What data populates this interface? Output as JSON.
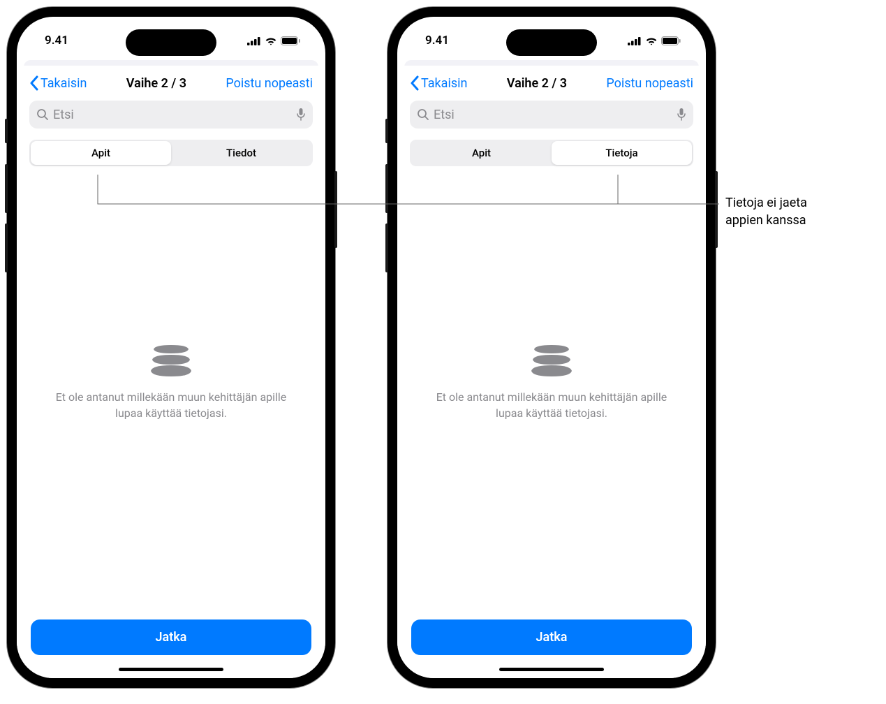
{
  "status": {
    "time": "9.41"
  },
  "nav": {
    "back": "Takaisin",
    "title": "Vaihe 2 / 3",
    "action": "Poistu nopeasti"
  },
  "search": {
    "placeholder": "Etsi"
  },
  "phones": [
    {
      "tabs": {
        "apps": "Apit",
        "info": "Tiedot"
      },
      "active": "apps"
    },
    {
      "tabs": {
        "apps": "Apit",
        "info": "Tietoja"
      },
      "active": "info"
    }
  ],
  "empty": {
    "text": "Et ole antanut millekään muun kehittäjän apille lupaa käyttää tietojasi."
  },
  "continue": {
    "label": "Jatka"
  },
  "callout": {
    "line1": "Tietoja ei jaeta",
    "line2": "appien kanssa"
  }
}
